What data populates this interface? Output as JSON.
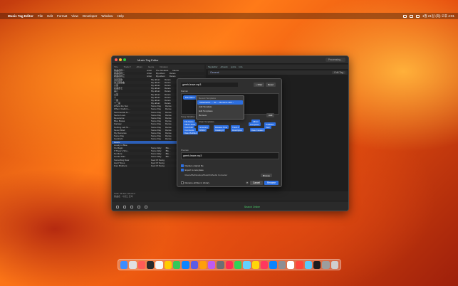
{
  "menubar": {
    "app_name": "Music Tag Editor",
    "items": [
      "File",
      "Edit",
      "Format",
      "View",
      "Developer",
      "Window",
      "Help"
    ],
    "clock": "1월 21일 (화) 오후 4:01"
  },
  "window": {
    "title": "Music Tag Editor",
    "right_label": "Processing...",
    "table_headers": [
      "Title",
      "Track #",
      "Album",
      "Genre",
      "Duration"
    ],
    "tracks": [
      {
        "title": "歌曲名称一",
        "artist": "Artist",
        "album": "The Greatest",
        "genre": "Dance"
      },
      {
        "title": "歌曲名称二",
        "artist": "Artist",
        "album": "My album",
        "genre": "Dance"
      },
      {
        "title": "歌曲名称三",
        "artist": "Artist",
        "album": "My album",
        "genre": "Dance"
      },
      {
        "title": "第四首歌",
        "artist": "",
        "album": "My album",
        "genre": "Dance"
      },
      {
        "title": "第五首歌曲",
        "artist": "",
        "album": "My album",
        "genre": "Dance"
      },
      {
        "title": "六首",
        "artist": "",
        "album": "My album",
        "genre": "Dance"
      },
      {
        "title": "名曲选七",
        "artist": "",
        "album": "My album",
        "genre": "Dance"
      },
      {
        "title": "第八",
        "artist": "",
        "album": "My album",
        "genre": "Dance"
      },
      {
        "title": "九首",
        "artist": "",
        "album": "My album",
        "genre": "Dance"
      },
      {
        "title": "十",
        "artist": "",
        "album": "My album",
        "genre": "Dance"
      },
      {
        "title": "一首",
        "artist": "",
        "album": "My album",
        "genre": "Dance"
      },
      {
        "title": "十二首",
        "artist": "",
        "album": "My album",
        "genre": "Dance"
      },
      {
        "title": "Where the Sun",
        "artist": "",
        "album": "Some Day",
        "genre": "Dance"
      },
      {
        "title": "When I Fall in L...",
        "artist": "",
        "album": "Some Day",
        "genre": "Dance"
      },
      {
        "title": "Sentimental Jo...",
        "artist": "",
        "album": "Some Day",
        "genre": "Dance"
      },
      {
        "title": "Secret Love",
        "artist": "",
        "album": "Some Day",
        "genre": "Dance"
      },
      {
        "title": "Reverence",
        "artist": "",
        "album": "Some Day",
        "genre": "Dance"
      },
      {
        "title": "Blue Bossa",
        "artist": "",
        "album": "Some Day",
        "genre": "Dance"
      },
      {
        "title": "Fantasy",
        "artist": "",
        "album": "Some Day",
        "genre": "Dance"
      },
      {
        "title": "Nothing Left To...",
        "artist": "",
        "album": "Some Day",
        "genre": "Dance"
      },
      {
        "title": "Never Mind",
        "artist": "",
        "album": "Some Day",
        "genre": "Dance"
      },
      {
        "title": "My Romance",
        "artist": "",
        "album": "Some Day",
        "genre": "Dance"
      },
      {
        "title": "Some Day",
        "artist": "",
        "album": "Some Day",
        "genre": "Dance"
      },
      {
        "title": "Gershwin",
        "artist": "",
        "album": "Some Day",
        "genre": "Dance"
      },
      {
        "title": "Gooru",
        "artist": "",
        "album": "",
        "genre": ""
      },
      {
        "title": "Lovely in Blue",
        "artist": "",
        "album": "",
        "genre": ""
      },
      {
        "title": "It's Magic",
        "artist": "",
        "album": "Some Way",
        "genre": "Blu..."
      },
      {
        "title": "If There's Stru...",
        "artist": "",
        "album": "Some Way",
        "genre": "Blu..."
      },
      {
        "title": "No More",
        "artist": "",
        "album": "Some Way",
        "genre": "Blu..."
      },
      {
        "title": "Gentle Rain",
        "artist": "",
        "album": "Some Way",
        "genre": "Blu..."
      },
      {
        "title": "Something New",
        "artist": "",
        "album": "Feel Of Swing",
        "genre": ""
      },
      {
        "title": "Hard Times",
        "artist": "",
        "album": "Feel Of Swing",
        "genre": ""
      },
      {
        "title": "Four Brothers",
        "artist": "",
        "album": "Feel Of Swing",
        "genre": ""
      }
    ],
    "tag_panel_tabs": [
      "Tag Editor",
      "Artwork",
      "Lyrics",
      "Info"
    ],
    "section_general": "General",
    "section_btn": "Edit Tag",
    "status_left": "Total: 34 files selected",
    "status_track": "歌曲名 · 사운드 트랙",
    "bottom_text": "Search Online"
  },
  "sheet": {
    "filename": "greeh-leave.mp3",
    "filter_label": "+ Filter",
    "reset_label": "Reset",
    "format_label": "Format",
    "token": "File Name",
    "menu_header": "Recent Templates",
    "menu_highlight": "%filePath% → %t → Rename with ~",
    "menu_add": "Add Template",
    "menu_edit": "Edit Templates",
    "menu_remove": "Remove",
    "clear_templates": "Clear Templates",
    "tag_variables_label": "Song Variables",
    "add_label": "Add",
    "tag_buttons": [
      "File Name",
      "Album Artist",
      "Copyright",
      "Comments",
      "Date Modified",
      "Grouping",
      "BPM #",
      "Release Time",
      "Catalog #",
      "Track #",
      "Description",
      "Album",
      "Date Created",
      "Composer",
      "Publisher",
      "Year"
    ],
    "preview_label": "Preview",
    "preview_value": "greeh-leave.mp3",
    "replace_original": "Replace original file",
    "export_new_place": "Export to new place",
    "export_path": "/Users/Me/Desktop/MusicKit/Audio Converter",
    "browse_label": "Browse",
    "rename_all": "Rename all files in Library",
    "help": "?",
    "cancel": "Cancel",
    "rename": "Rename"
  },
  "dock": {
    "icon_colors": [
      "#3a8dff",
      "#e0e0e0",
      "#ff5b55",
      "#2a2a2a",
      "#f5f5f5",
      "#ffcc00",
      "#34c759",
      "#0a84ff",
      "#5e5ce6",
      "#ff9f0a",
      "#bf5af2",
      "#6e6e73",
      "#ff2d55",
      "#30d158",
      "#64d2ff",
      "#ffd60a",
      "#ff375f",
      "#0a84ff",
      "#8e8e93",
      "#ffffff",
      "#ff453a",
      "#5ac8fa",
      "#1c1c1e",
      "#9d9d9d",
      "#cfcfcf"
    ]
  }
}
